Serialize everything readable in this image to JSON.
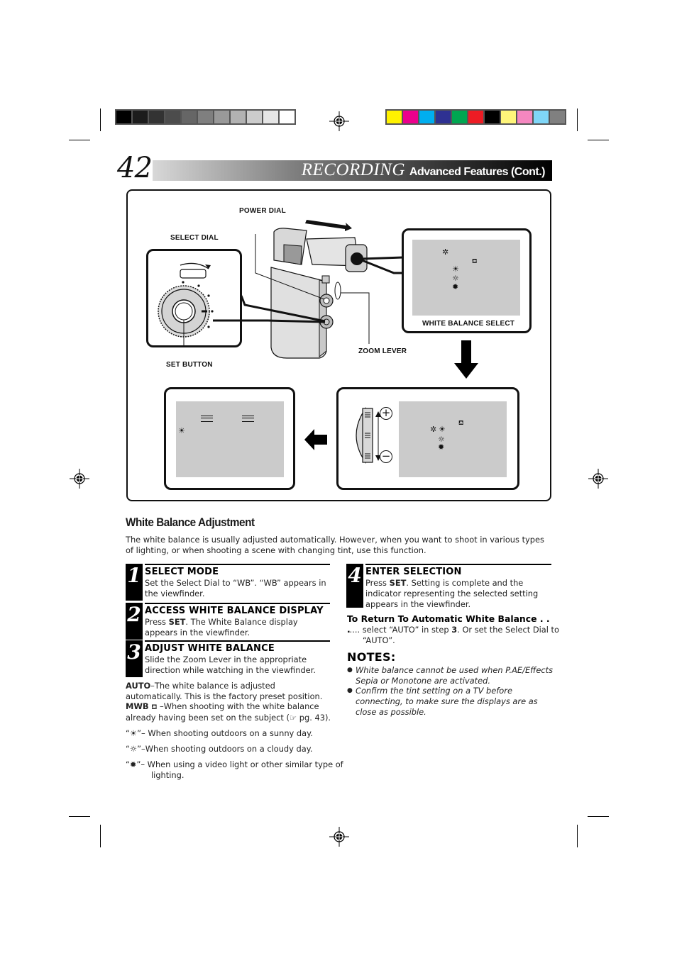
{
  "print_marks": {
    "grayscale_swatches": [
      "#000000",
      "#1c1c1c",
      "#333333",
      "#4c4c4c",
      "#666666",
      "#7f7f7f",
      "#999999",
      "#b2b2b2",
      "#cccccc",
      "#e5e5e5",
      "#ffffff"
    ],
    "color_swatches": [
      "#fff200",
      "#ec008c",
      "#00aeef",
      "#2e3192",
      "#00a651",
      "#ed1c24",
      "#000000",
      "#fff57a",
      "#f587c0",
      "#7fd6f7",
      "#808080"
    ]
  },
  "header": {
    "page_number": "42",
    "section_title": "RECORDING",
    "subtitle": "Advanced Features (Cont.)"
  },
  "figure": {
    "labels": {
      "power_dial": "POWER DIAL",
      "select_dial": "SELECT DIAL",
      "set_button": "SET BUTTON",
      "zoom_lever": "ZOOM LEVER",
      "white_balance_select": "WHITE BALANCE SELECT"
    },
    "icons": {
      "select_screen": [
        "auto-cursor-icon",
        "mwb-icon",
        "sunny-icon",
        "cloudy-icon",
        "halogen-icon"
      ],
      "adjust_screen": [
        "auto-cursor-icon",
        "sunny-icon",
        "mwb-icon",
        "cloudy-icon",
        "halogen-icon"
      ],
      "result_screen": [
        "sunny-icon"
      ]
    },
    "zoom_lever_signs": {
      "plus": "+",
      "minus": "−"
    }
  },
  "section": {
    "title": "White Balance Adjustment",
    "intro": "The white balance is usually adjusted automatically. However, when you want to shoot in various types of lighting, or when shooting a scene with changing tint, use this function."
  },
  "steps": [
    {
      "number": "1",
      "title": "SELECT MODE",
      "body": "Set the Select Dial to “WB”. “WB” appears in the viewfinder."
    },
    {
      "number": "2",
      "title": "ACCESS WHITE BALANCE DISPLAY",
      "body_pre": "Press ",
      "body_bold": "SET",
      "body_post": ". The White Balance display appears in the viewfinder."
    },
    {
      "number": "3",
      "title": "ADJUST WHITE BALANCE",
      "body": "Slide the Zoom Lever in the appropriate direction while watching in the viewfinder."
    },
    {
      "number": "4",
      "title": "ENTER SELECTION",
      "body_pre": "Press ",
      "body_bold": "SET",
      "body_post": ". Setting is complete and the indicator representing the selected setting appears in the viewfinder."
    }
  ],
  "modes": {
    "auto_label": "AUTO",
    "auto_text": "–The white balance is adjusted automatically. This is the factory preset position.",
    "mwb_label": "MWB",
    "mwb_text": " –When shooting with the white balance already having been set on the subject (",
    "mwb_ref": " pg. 43).",
    "sunny_text": "– When shooting outdoors on a sunny day.",
    "cloudy_text": "–When shooting outdoors on a cloudy day.",
    "halogen_text": "– When using a video light or other similar type of lighting."
  },
  "return_auto": {
    "title": "To Return To Automatic White Balance . . .",
    "body_pre": "..... select “AUTO” in step ",
    "body_bold": "3",
    "body_post": ". Or set the Select Dial to “AUTO”."
  },
  "notes": {
    "title": "NOTES:",
    "items": [
      "White balance cannot be used when P.AE/Effects Sepia or Monotone are activated.",
      "Confirm the tint setting on a TV before connecting, to make sure the displays are as close as possible."
    ]
  }
}
